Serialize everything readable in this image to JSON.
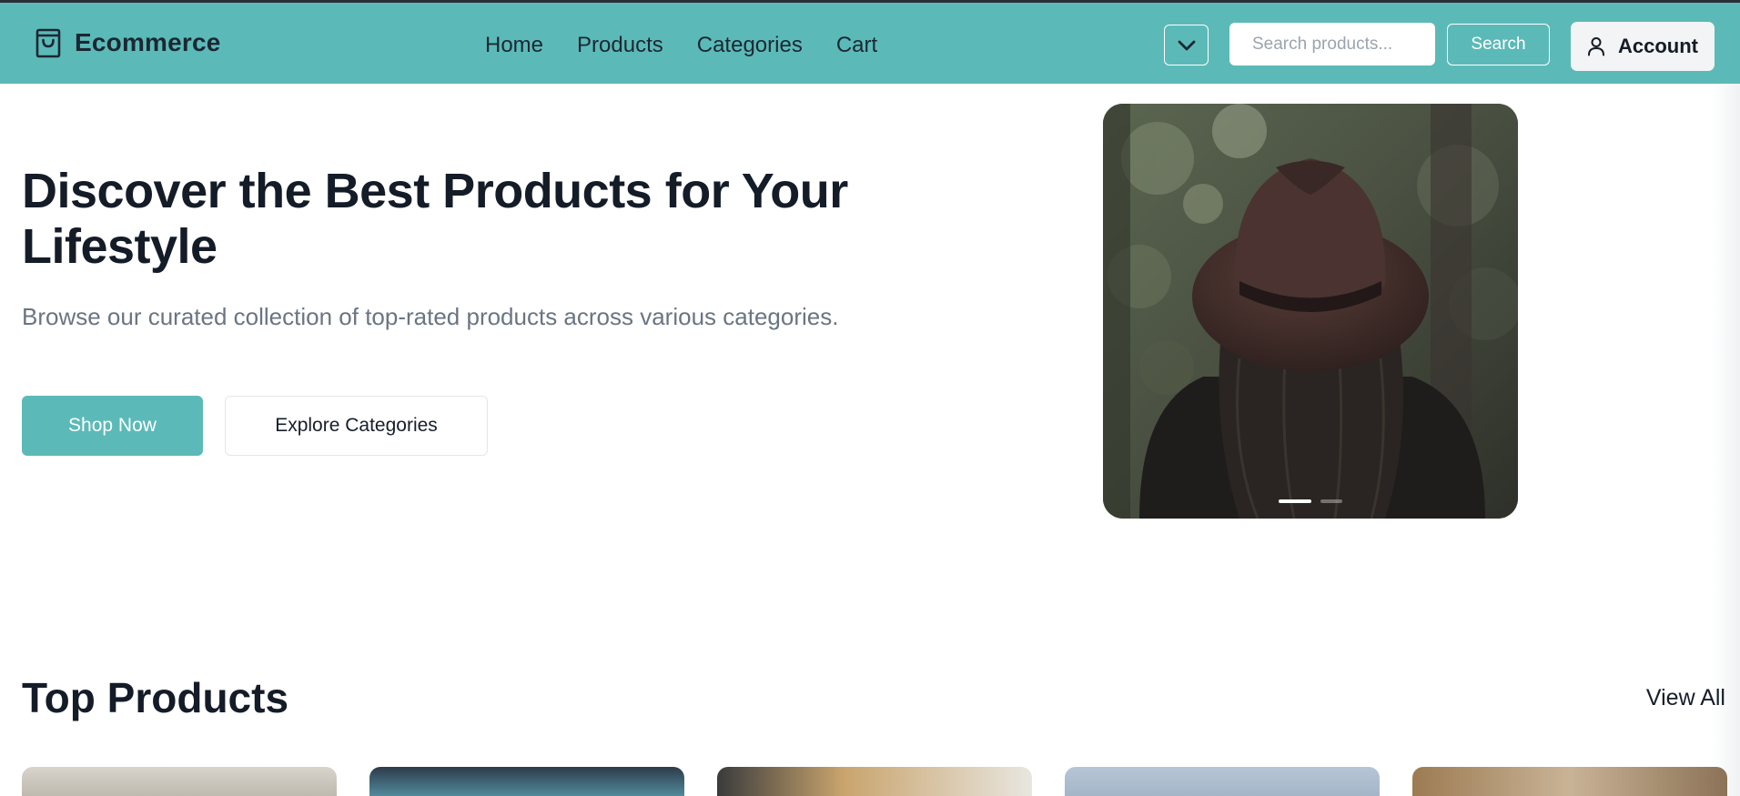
{
  "header": {
    "brand": "Ecommerce",
    "nav": [
      "Home",
      "Products",
      "Categories",
      "Cart"
    ],
    "search_placeholder": "Search products...",
    "search_button": "Search",
    "account_label": "Account"
  },
  "hero": {
    "title": "Discover the Best Products for Your Lifestyle",
    "subtitle": "Browse our curated collection of top-rated products across various categories.",
    "primary_cta": "Shop Now",
    "secondary_cta": "Explore Categories",
    "carousel": {
      "active_slide": 1,
      "slide_count": 2
    }
  },
  "top_products": {
    "title": "Top Products",
    "view_all": "View All",
    "cards": [
      "product-1",
      "product-2",
      "product-3",
      "product-4",
      "product-5"
    ]
  },
  "colors": {
    "accent": "#5bbab8",
    "text_dark": "#141c28",
    "text_muted": "#6a7582"
  },
  "icons": [
    "shopping-bag-icon",
    "chevron-down-icon",
    "user-icon"
  ]
}
